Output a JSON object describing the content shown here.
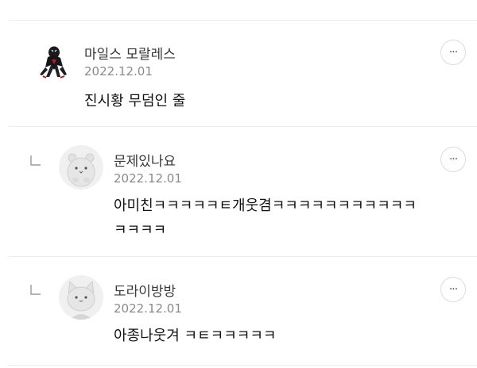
{
  "comments": [
    {
      "author": "마일스 모랄레스",
      "date": "2022.12.01",
      "text": "진시황 무덤인 줄",
      "avatar_icon": "spiderman-avatar-icon",
      "more_icon": "···"
    },
    {
      "author": "문제있나요",
      "date": "2022.12.01",
      "text_line1": "아미친ㅋㅋㅋㅋㅋㅌ개웃겸ㅋㅋㅋㅋㅋㅋㅋㅋㅋㅋㅋ",
      "text_line2": "ㅋㅋㅋㅋ",
      "avatar_icon": "hamster-avatar-icon",
      "reply_icon": "reply-arrow-icon",
      "more_icon": "···"
    },
    {
      "author": "도라이방방",
      "date": "2022.12.01",
      "text": "아종나웃겨 ㅋㅌㅋㅋㅋㅋㅋ",
      "avatar_icon": "cat-avatar-icon",
      "reply_icon": "reply-arrow-icon",
      "more_icon": "···"
    }
  ]
}
